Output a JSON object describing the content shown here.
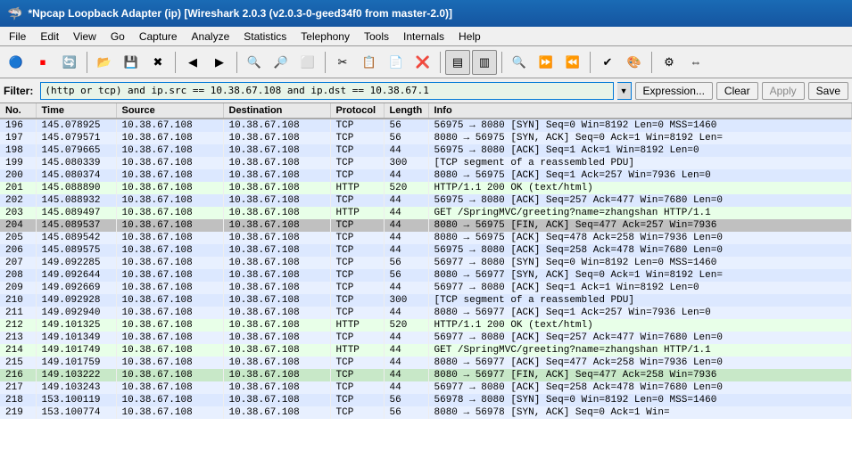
{
  "titleBar": {
    "title": "*Npcap Loopback Adapter (ip) [Wireshark 2.0.3 (v2.0.3-0-geed34f0 from master-2.0)]"
  },
  "menuBar": {
    "items": [
      "File",
      "Edit",
      "View",
      "Go",
      "Capture",
      "Analyze",
      "Statistics",
      "Telephony",
      "Tools",
      "Internals",
      "Help"
    ]
  },
  "toolbar": {
    "buttons": [
      "🔵",
      "⏹",
      "📋",
      "🔄",
      "⏪",
      "◀",
      "▶",
      "⏩",
      "🔍",
      "🔎",
      "🔲",
      "↩",
      "↪",
      "📥",
      "📤",
      "✂",
      "⎘",
      "📋",
      "❌",
      "🔍",
      "🔍",
      "🔍",
      "🖥",
      "🌐",
      "⚙",
      "🔧"
    ]
  },
  "filterBar": {
    "label": "Filter:",
    "value": "(http or tcp) and ip.src == 10.38.67.108 and ip.dst == 10.38.67.1",
    "expressionBtn": "Expression...",
    "clearBtn": "Clear",
    "applyBtn": "Apply",
    "saveBtn": "Save"
  },
  "table": {
    "columns": [
      "No.",
      "Time",
      "Source",
      "Destination",
      "Protocol",
      "Length",
      "Info"
    ],
    "rows": [
      {
        "no": "196",
        "time": "145.078925",
        "src": "10.38.67.108",
        "dst": "10.38.67.108",
        "proto": "TCP",
        "len": "56",
        "info": "56975 → 8080 [SYN] Seq=0 Win=8192 Len=0 MSS=1460",
        "color": "tcp"
      },
      {
        "no": "197",
        "time": "145.079571",
        "src": "10.38.67.108",
        "dst": "10.38.67.108",
        "proto": "TCP",
        "len": "56",
        "info": "8080 → 56975 [SYN, ACK] Seq=0 Ack=1 Win=8192 Len=",
        "color": "tcp"
      },
      {
        "no": "198",
        "time": "145.079665",
        "src": "10.38.67.108",
        "dst": "10.38.67.108",
        "proto": "TCP",
        "len": "44",
        "info": "56975 → 8080 [ACK] Seq=1 Ack=1 Win=8192 Len=0",
        "color": "tcp"
      },
      {
        "no": "199",
        "time": "145.080339",
        "src": "10.38.67.108",
        "dst": "10.38.67.108",
        "proto": "TCP",
        "len": "300",
        "info": "[TCP segment of a reassembled PDU]",
        "color": "tcp"
      },
      {
        "no": "200",
        "time": "145.080374",
        "src": "10.38.67.108",
        "dst": "10.38.67.108",
        "proto": "TCP",
        "len": "44",
        "info": "8080 → 56975 [ACK] Seq=1 Ack=257 Win=7936 Len=0",
        "color": "tcp"
      },
      {
        "no": "201",
        "time": "145.088890",
        "src": "10.38.67.108",
        "dst": "10.38.67.108",
        "proto": "HTTP",
        "len": "520",
        "info": "HTTP/1.1 200 OK  (text/html)",
        "color": "http"
      },
      {
        "no": "202",
        "time": "145.088932",
        "src": "10.38.67.108",
        "dst": "10.38.67.108",
        "proto": "TCP",
        "len": "44",
        "info": "56975 → 8080 [ACK] Seq=257 Ack=477 Win=7680 Len=0",
        "color": "tcp"
      },
      {
        "no": "203",
        "time": "145.089497",
        "src": "10.38.67.108",
        "dst": "10.38.67.108",
        "proto": "HTTP",
        "len": "44",
        "info": "GET /SpringMVC/greeting?name=zhangshan HTTP/1.1",
        "color": "http"
      },
      {
        "no": "204",
        "time": "145.089537",
        "src": "10.38.67.108",
        "dst": "10.38.67.108",
        "proto": "TCP",
        "len": "44",
        "info": "8080 → 56975 [FIN, ACK] Seq=477 Ack=257 Win=7936",
        "color": "selected"
      },
      {
        "no": "205",
        "time": "145.089542",
        "src": "10.38.67.108",
        "dst": "10.38.67.108",
        "proto": "TCP",
        "len": "44",
        "info": "8080 → 56975 [ACK] Seq=478 Ack=258 Win=7936 Len=0",
        "color": "tcp"
      },
      {
        "no": "206",
        "time": "145.089575",
        "src": "10.38.67.108",
        "dst": "10.38.67.108",
        "proto": "TCP",
        "len": "44",
        "info": "56975 → 8080 [ACK] Seq=258 Ack=478 Win=7680 Len=0",
        "color": "tcp"
      },
      {
        "no": "207",
        "time": "149.092285",
        "src": "10.38.67.108",
        "dst": "10.38.67.108",
        "proto": "TCP",
        "len": "56",
        "info": "56977 → 8080 [SYN] Seq=0 Win=8192 Len=0 MSS=1460",
        "color": "tcp"
      },
      {
        "no": "208",
        "time": "149.092644",
        "src": "10.38.67.108",
        "dst": "10.38.67.108",
        "proto": "TCP",
        "len": "56",
        "info": "8080 → 56977 [SYN, ACK] Seq=0 Ack=1 Win=8192 Len=",
        "color": "tcp"
      },
      {
        "no": "209",
        "time": "149.092669",
        "src": "10.38.67.108",
        "dst": "10.38.67.108",
        "proto": "TCP",
        "len": "44",
        "info": "56977 → 8080 [ACK] Seq=1 Ack=1 Win=8192 Len=0",
        "color": "tcp"
      },
      {
        "no": "210",
        "time": "149.092928",
        "src": "10.38.67.108",
        "dst": "10.38.67.108",
        "proto": "TCP",
        "len": "300",
        "info": "[TCP segment of a reassembled PDU]",
        "color": "tcp"
      },
      {
        "no": "211",
        "time": "149.092940",
        "src": "10.38.67.108",
        "dst": "10.38.67.108",
        "proto": "TCP",
        "len": "44",
        "info": "8080 → 56977 [ACK] Seq=1 Ack=257 Win=7936 Len=0",
        "color": "tcp"
      },
      {
        "no": "212",
        "time": "149.101325",
        "src": "10.38.67.108",
        "dst": "10.38.67.108",
        "proto": "HTTP",
        "len": "520",
        "info": "HTTP/1.1 200 OK  (text/html)",
        "color": "http"
      },
      {
        "no": "213",
        "time": "149.101349",
        "src": "10.38.67.108",
        "dst": "10.38.67.108",
        "proto": "TCP",
        "len": "44",
        "info": "56977 → 8080 [ACK] Seq=257 Ack=477 Win=7680 Len=0",
        "color": "tcp"
      },
      {
        "no": "214",
        "time": "149.101749",
        "src": "10.38.67.108",
        "dst": "10.38.67.108",
        "proto": "HTTP",
        "len": "44",
        "info": "GET /SpringMVC/greeting?name=zhangshan HTTP/1.1",
        "color": "http"
      },
      {
        "no": "215",
        "time": "149.101759",
        "src": "10.38.67.108",
        "dst": "10.38.67.108",
        "proto": "TCP",
        "len": "44",
        "info": "8080 → 56977 [ACK] Seq=477 Ack=258 Win=7936 Len=0",
        "color": "tcp"
      },
      {
        "no": "216",
        "time": "149.103222",
        "src": "10.38.67.108",
        "dst": "10.38.67.108",
        "proto": "TCP",
        "len": "44",
        "info": "8080 → 56977 [FIN, ACK] Seq=477 Ack=258 Win=7936",
        "color": "green-dark"
      },
      {
        "no": "217",
        "time": "149.103243",
        "src": "10.38.67.108",
        "dst": "10.38.67.108",
        "proto": "TCP",
        "len": "44",
        "info": "56977 → 8080 [ACK] Seq=258 Ack=478 Win=7680 Len=0",
        "color": "tcp"
      },
      {
        "no": "218",
        "time": "153.100119",
        "src": "10.38.67.108",
        "dst": "10.38.67.108",
        "proto": "TCP",
        "len": "56",
        "info": "56978 → 8080 [SYN] Seq=0 Win=8192 Len=0 MSS=1460",
        "color": "tcp"
      },
      {
        "no": "219",
        "time": "153.100774",
        "src": "10.38.67.108",
        "dst": "10.38.67.108",
        "proto": "TCP",
        "len": "56",
        "info": "8080 → 56978 [SYN, ACK] Seq=0 Ack=1 Win=",
        "color": "tcp"
      }
    ]
  }
}
